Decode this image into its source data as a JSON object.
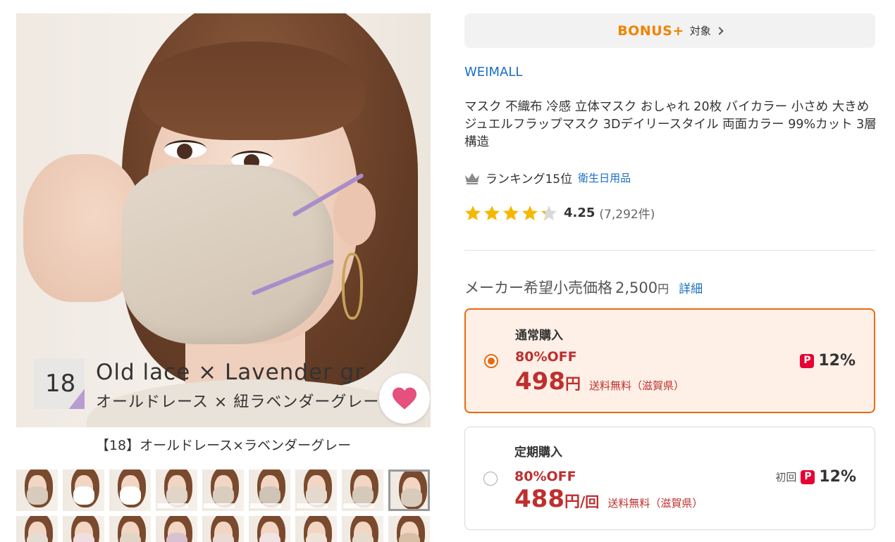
{
  "gallery": {
    "color_number": "18",
    "color_name_en": "Old lace × Lavender gr",
    "color_name_jp": "オールドレース × 紐ラベンダーグレー",
    "caption": "【18】オールドレース×ラベンダーグレー",
    "favorite_icon": "heart-icon",
    "thumbnails_row1_masks": [
      "#d8cbbb",
      "#ffffff",
      "#ffffff",
      "#e0d5c8",
      "#d9cdbf",
      "#cfc4b6",
      "#e4d9cc",
      "#d5c9ba",
      "#d8cbbb"
    ],
    "thumbnails_row2_masks": [
      "#e6ddd2",
      "#f0dfe0",
      "#e2d5c5",
      "#d9c2cf",
      "#eadbd5",
      "#f1e2e3",
      "#efe3d8",
      "#e6dccd",
      "#d8c0a8"
    ],
    "selected_thumbnail": 9
  },
  "bonus": {
    "logo": "BONUS+",
    "label": "対象",
    "chevron_icon": "chevron-right-icon"
  },
  "shop": {
    "name": "WEIMALL"
  },
  "product": {
    "title": "マスク 不織布 冷感 立体マスク おしゃれ 20枚 バイカラー 小さめ 大きめ ジュエルフラップマスク 3Dデイリースタイル 両面カラー 99%カット 3層構造"
  },
  "ranking": {
    "icon": "crown-icon",
    "label": "ランキング15位",
    "category": "衛生日用品"
  },
  "rating": {
    "value": 4.25,
    "score_text": "4.25",
    "count_text": "(7,292件)",
    "star_color": "#f5b800"
  },
  "mrp": {
    "label": "メーカー希望小売価格",
    "price": "2,500",
    "yen": "円",
    "detail_link": "詳細"
  },
  "plans": {
    "normal": {
      "type": "通常購入",
      "discount": "80%OFF",
      "price": "498",
      "yen": "円",
      "shipping": "送料無料（滋賀県）",
      "points": "12%",
      "selected": true
    },
    "subscription": {
      "type": "定期購入",
      "discount": "80%OFF",
      "price": "488",
      "yen": "円",
      "per": "/回",
      "shipping": "送料無料（滋賀県）",
      "first_label": "初回",
      "points": "12%",
      "selected": false
    }
  },
  "colors": {
    "accent_orange": "#e86a13",
    "price_red": "#bf2f2f",
    "link_blue": "#1a6fc4",
    "bonus_orange": "#f08300",
    "heart_pink": "#e5507c",
    "paypay_red": "#e60033"
  }
}
